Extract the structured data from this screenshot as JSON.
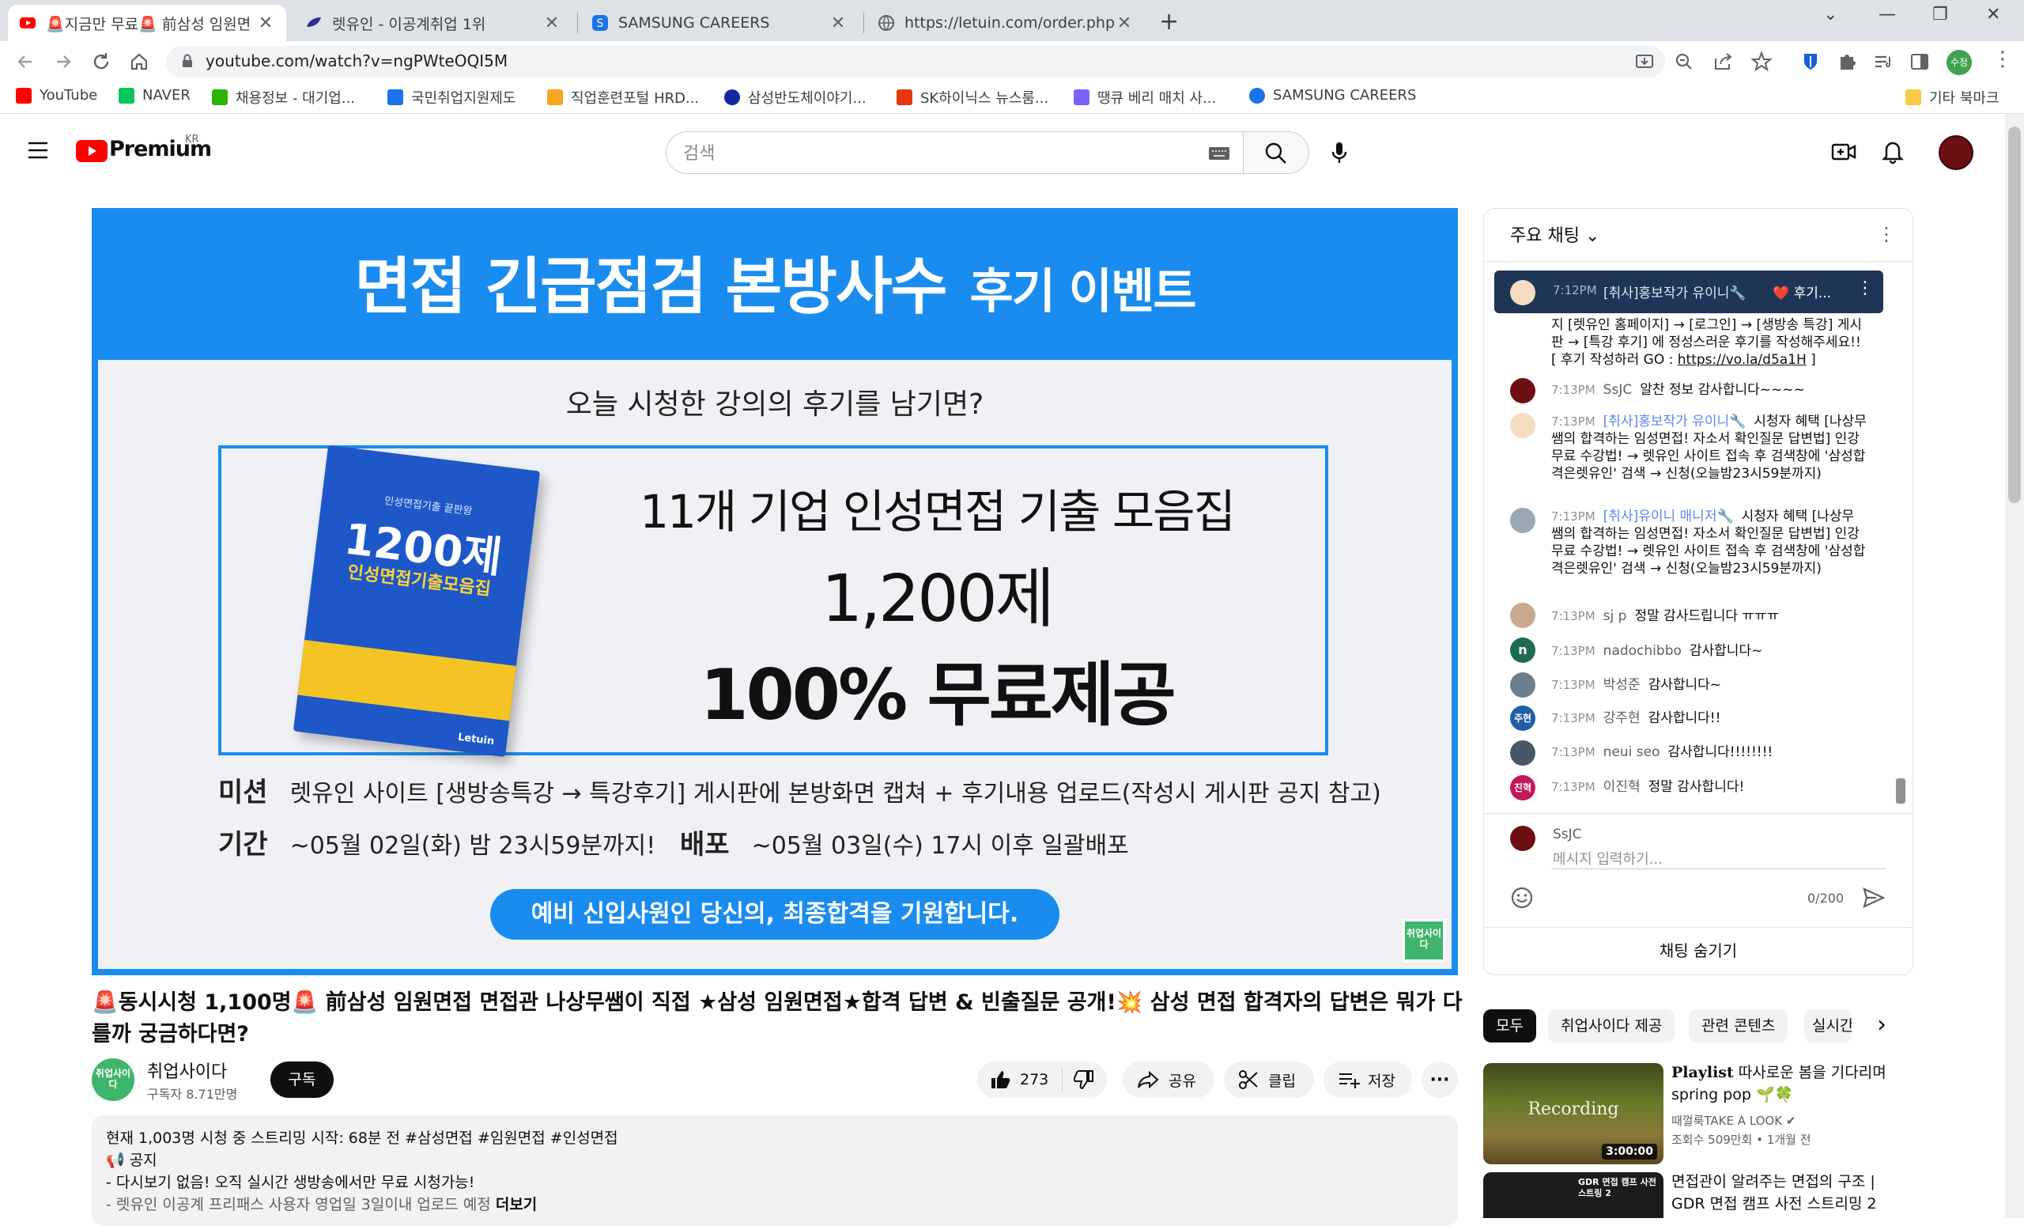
{
  "browser": {
    "tabs": [
      {
        "title": "🚨지금만 무료🚨 前삼성 임원면"
      },
      {
        "title": "렛유인 - 이공계취업 1위"
      },
      {
        "title": "SAMSUNG CAREERS"
      },
      {
        "title": "https://letuin.com/order.php"
      }
    ],
    "url": "youtube.com/watch?v=ngPWteOQI5M",
    "profile_label": "수정",
    "bookmarks": [
      {
        "label": "YouTube",
        "color": "#ff0000"
      },
      {
        "label": "NAVER",
        "color": "#03c75a"
      },
      {
        "label": "채용정보 - 대기업...",
        "color": "#2db400"
      },
      {
        "label": "국민취업지원제도",
        "color": "#1a73e8"
      },
      {
        "label": "직업훈련포털 HRD...",
        "color": "#f5a623"
      },
      {
        "label": "삼성반도체이야기...",
        "color": "#1428a0"
      },
      {
        "label": "SK하이닉스 뉴스룸...",
        "color": "#e8380d"
      },
      {
        "label": "땡큐 베리 매치 사...",
        "color": "#7b61ff"
      },
      {
        "label": "SAMSUNG CAREERS",
        "color": "#1a73e8"
      }
    ],
    "other_bookmarks": "기타 북마크"
  },
  "youtube": {
    "logo": "Premium",
    "region": "KR",
    "search_placeholder": "검색"
  },
  "video": {
    "banner_title": "면접 긴급점검 본방사수",
    "banner_sub": "후기 이벤트",
    "question": "오늘 시청한 강의의 후기를 남기면?",
    "book_top": "인성면접기출 끝판왕",
    "book_big": "1200제",
    "book_mid": "인성면접기출모음집",
    "book_brand": "Letuin",
    "line1": "11개 기업 인성면접 기출 모음집",
    "line2": "1,200제",
    "line3": "100% 무료제공",
    "mission_label": "미션",
    "mission_text": "렛유인 사이트 [생방송특강 → 특강후기] 게시판에 본방화면 캡쳐 + 후기내용 업로드(작성시 게시판 공지 참고)",
    "period_label": "기간",
    "period_text": "~05월 02일(화) 밤 23시59분까지!",
    "dist_label": "배포",
    "dist_text": "~05월 03일(수) 17시 이후 일괄배포",
    "pill": "예비 신입사원인 당신의, 최종합격을 기원합니다.",
    "corner": "취업사이다"
  },
  "watch": {
    "title": "🚨동시시청 1,100명🚨 前삼성 임원면접 면접관 나상무쌤이 직접 ★삼성 임원면접★합격 답변 & 빈출질문 공개!💥 삼성 면접 합격자의 답변은 뭐가 다를까 궁금하다면?",
    "channel": "취업사이다",
    "channel_avatar": "취업사이다",
    "subscribers": "구독자 8.71만명",
    "subscribe": "구독",
    "likes": "273",
    "share": "공유",
    "clip": "클립",
    "save": "저장",
    "desc_stats": "현재 1,003명 시청 중  스트리밍 시작: 68분 전",
    "desc_tags": "#삼성면접 #임원면접 #인성면접",
    "desc_notice": "📢 공지",
    "desc_line3": "- 다시보기 없음! 오직 실시간 생방송에서만 무료 시청가능!",
    "desc_line4": "- 렛유인 이공계 프리패스 사용자 영업일 3일이내 업로드 예정",
    "more": "더보기"
  },
  "chat": {
    "header": "주요 채팅",
    "pinned": {
      "time": "7:12PM",
      "author": "[취사]홍보작가 유이니🔧",
      "text": "❤️ 후기..."
    },
    "overflow_text": "지 [렛유인 홈페이지] → [로그인] → [생방송 특강] 게시판 → [특강 후기] 에 정성스러운 후기를 작성해주세요!! [ 후기 작성하러 GO : ",
    "overflow_link": "https://vo.la/d5a1H",
    "overflow_end": " ]",
    "messages": [
      {
        "time": "7:13PM",
        "author": "SsJC",
        "text": "알찬 정보 감사합니다~~~~"
      },
      {
        "time": "7:13PM",
        "author": "[취사]홍보작가 유이니🔧",
        "text": "시청자 혜택 [나상무 쌤의 합격하는 임성면접! 자소서 확인질문 답변법] 인강 무료 수강법! → 렛유인 사이트 접속 후 검색창에 '삼성합격은렛유인' 검색 → 신청(오늘밤23시59분까지)"
      },
      {
        "time": "7:13PM",
        "author": "[취사]유이니 매니저🔧",
        "text": "시청자 혜택 [나상무 쌤의 합격하는 임성면접! 자소서 확인질문 답변법] 인강 무료 수강법! → 렛유인 사이트 접속 후 검색창에 '삼성합격은렛유인' 검색 → 신청(오늘밤23시59분까지)"
      },
      {
        "time": "7:13PM",
        "author": "sj p",
        "text": "정말 감사드립니다 ㅠㅠㅠ"
      },
      {
        "time": "7:13PM",
        "author": "nadochibbo",
        "text": "감사합니다~"
      },
      {
        "time": "7:13PM",
        "author": "박성준",
        "text": "감사합니다~"
      },
      {
        "time": "7:13PM",
        "author": "강주현",
        "text": "감사합니다!!"
      },
      {
        "time": "7:13PM",
        "author": "neui seo",
        "text": "감사합니다!!!!!!!!"
      },
      {
        "time": "7:13PM",
        "author": "이진혁",
        "text": "정말 감사합니다!"
      }
    ],
    "avatar_letters": {
      "n": "n",
      "kang": "주현",
      "lee": "진혁"
    },
    "input_user": "SsJC",
    "input_placeholder": "메시지 입력하기...",
    "counter": "0/200",
    "hide": "채팅 숨기기"
  },
  "recommendations": {
    "chips": [
      "모두",
      "취업사이다 제공",
      "관련 콘텐츠",
      "실시간"
    ],
    "items": [
      {
        "title_bold": "Playlist",
        "title": " 따사로운 봄을 기다리며 spring pop 🌱🍀",
        "channel": "때껄룩TAKE A LOOK",
        "meta": "조회수 509만회 • 1개월 전",
        "thumb_text": "Recording",
        "duration": "3:00:00"
      },
      {
        "title": "면접관이 알려주는 면접의 구조 | GDR 면접 캠프 사전 스트리밍 2",
        "thumb_text": "GDR 면접 캠프 사전 스트링 2"
      }
    ]
  },
  "colors": {
    "yt_red": "#ff0000",
    "video_blue": "#1a8cf0",
    "pinned_bg": "#1f3558",
    "mod_blue": "#5e84f1"
  }
}
